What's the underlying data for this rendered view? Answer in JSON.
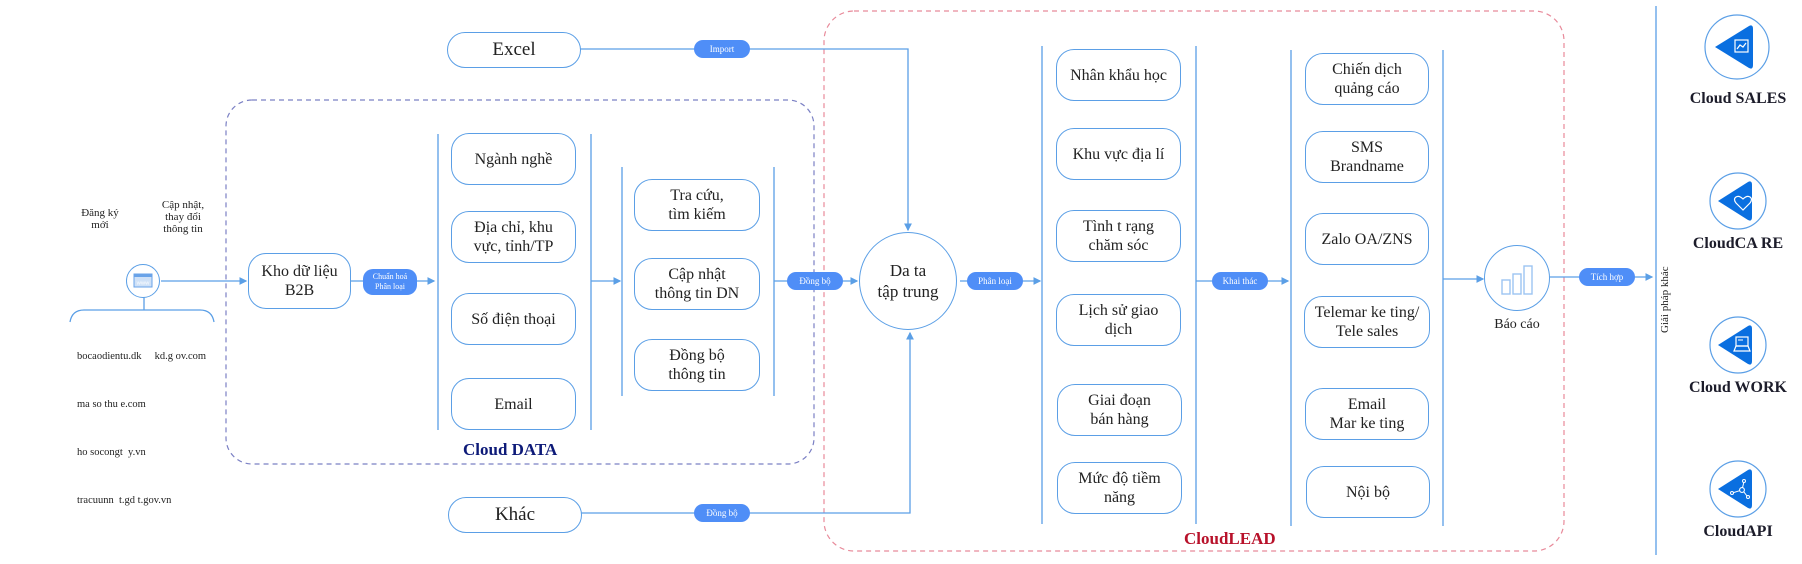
{
  "colors": {
    "line": "#5b9fe6",
    "tag": "#4f8ef7",
    "cloud_data_title": "#0d1a78",
    "cloud_lead_title": "#b8112a",
    "cloud_data_border": "#7b80c4",
    "cloud_lead_border": "#e88a9a",
    "product_icon": "#0a6fe0"
  },
  "sources": {
    "register_label": "Đăng ký\nmới",
    "update_label": "Cập nhật,\nthay đổi\nthông   tin",
    "web_icon": "www-browser-icon",
    "websites": [
      "bocaodientu.dk     kd.g ov.com",
      "ma so thu e.com",
      "ho socongt  y.vn",
      "tracuunn  t.gd t.gov.vn"
    ]
  },
  "inputs": {
    "excel": "Excel",
    "excel_tag": "Import",
    "other": "Khác",
    "other_tag": "Đồng bộ"
  },
  "cloud_data": {
    "title": "Cloud DATA",
    "warehouse": "Kho dữ liệu\nB2B",
    "normalize_tag": "Chuẩn hoá\nPhân loại",
    "attributes": [
      "Ngành nghề",
      "Địa chỉ, khu\nvực, tỉnh/TP",
      "Số điện thoại",
      "Email"
    ],
    "functions": [
      "Tra cứu,\ntìm kiếm",
      "Cập nhật\nthông   tin DN",
      "Đồng bộ\nthông   tin"
    ],
    "sync_tag": "Đồng bộ"
  },
  "cloud_lead": {
    "title": "CloudLEAD",
    "center": "Da ta\ntập trung",
    "classify_tag": "Phân loại",
    "segments": [
      "Nhân khẩu học",
      "Khu vực địa lí",
      "Tình t rạng\nchăm   sóc",
      "Lịch sử giao\ndịch",
      "Giai đoạn\nbán hàng",
      "Mức độ  tiềm\nnăng"
    ],
    "exploit_tag": "Khai thác",
    "channels": [
      "Chiến dịch\nquảng cáo",
      "SMS\nBrandname",
      "Zalo  OA/ZNS",
      "Telemar  ke ting/\nTele sales",
      "Email\nMar ke ting",
      "Nội bộ"
    ],
    "report_label": "Báo cáo",
    "report_icon": "bar-chart-icon"
  },
  "integration": {
    "tag": "Tích hợp",
    "side_label": "Giải pháp khác"
  },
  "products": [
    {
      "name": "Cloud SALES",
      "icon": "line-chart-icon"
    },
    {
      "name": "CloudCA RE",
      "icon": "heart-icon"
    },
    {
      "name": "Cloud WORK",
      "icon": "laptop-icon"
    },
    {
      "name": "CloudAPI",
      "icon": "network-nodes-icon"
    }
  ]
}
